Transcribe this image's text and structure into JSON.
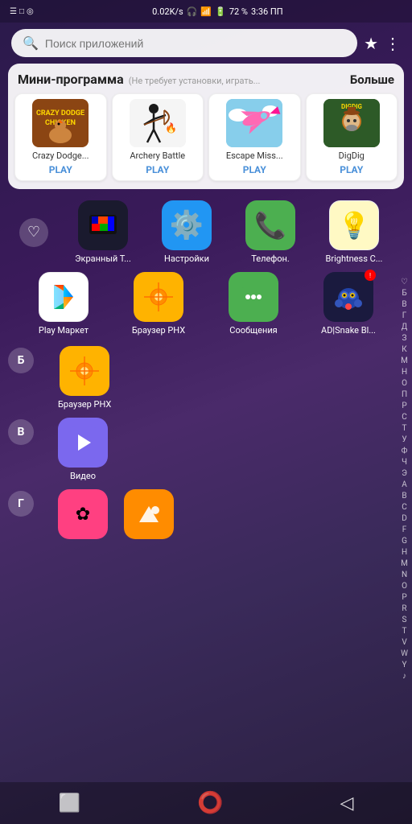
{
  "statusBar": {
    "speed": "0.02K/s",
    "battery": "72 %",
    "time": "3:36 ПП"
  },
  "search": {
    "placeholder": "Поиск приложений"
  },
  "miniSection": {
    "title": "Мини-программа",
    "subtitle": "(Не требует установки, играть...",
    "more": "Больше",
    "games": [
      {
        "name": "Crazy Dodge...",
        "play": "PLAY"
      },
      {
        "name": "Archery Battle",
        "play": "PLAY"
      },
      {
        "name": "Escape Miss...",
        "play": "PLAY"
      },
      {
        "name": "DigDig",
        "play": "PLAY"
      }
    ]
  },
  "favButton": "♡",
  "appGrid1": [
    {
      "name": "Экранный Т...",
      "icon": "tv"
    },
    {
      "name": "Настройки",
      "icon": "settings"
    },
    {
      "name": "Телефон.",
      "icon": "phone"
    },
    {
      "name": "Brightness C...",
      "icon": "brightness"
    }
  ],
  "appGrid2": [
    {
      "name": "Play Маркет",
      "icon": "playstore"
    },
    {
      "name": "Браузер PHX",
      "icon": "browser-phx"
    },
    {
      "name": "Сообщения",
      "icon": "messages"
    },
    {
      "name": "AD|Snake Bl...",
      "icon": "snake",
      "badge": "!"
    }
  ],
  "sectionБ": {
    "letter": "Б",
    "apps": [
      {
        "name": "Браузер PHX",
        "icon": "browser-phx"
      }
    ]
  },
  "sectionВ": {
    "letter": "В",
    "apps": [
      {
        "name": "Видео",
        "icon": "video"
      }
    ]
  },
  "sectionГ": {
    "letter": "Г",
    "apps": [
      {
        "name": "",
        "icon": "flower"
      },
      {
        "name": "",
        "icon": "gallery"
      }
    ]
  },
  "alphaIndex": [
    "♡",
    "Б",
    "В",
    "Г",
    "Д",
    "З",
    "К",
    "М",
    "Н",
    "О",
    "П",
    "Р",
    "С",
    "Т",
    "У",
    "Ф",
    "Ч",
    "Э",
    "А",
    "B",
    "C",
    "D",
    "F",
    "G",
    "H",
    "M",
    "N",
    "O",
    "P",
    "R",
    "S",
    "T",
    "V",
    "W",
    "Y",
    "♪"
  ],
  "navBar": {
    "square": "□",
    "circle": "○",
    "triangle": "◁"
  }
}
